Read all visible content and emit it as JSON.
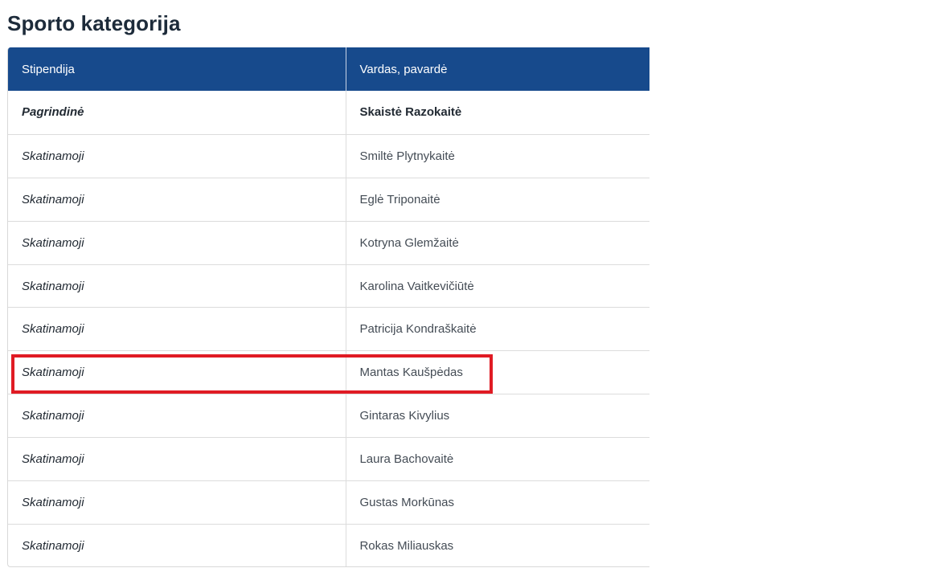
{
  "section_title": "Sporto kategorija",
  "table": {
    "headers": [
      "Stipendija",
      "Vardas, pavardė"
    ],
    "rows": [
      {
        "stipendija": "Pagrindinė",
        "vardas": "Skaistė Razokaitė"
      },
      {
        "stipendija": "Skatinamoji",
        "vardas": "Smiltė Plytnykaitė"
      },
      {
        "stipendija": "Skatinamoji",
        "vardas": "Eglė Triponaitė"
      },
      {
        "stipendija": "Skatinamoji",
        "vardas": "Kotryna Glemžaitė"
      },
      {
        "stipendija": "Skatinamoji",
        "vardas": "Karolina Vaitkevičiūtė"
      },
      {
        "stipendija": "Skatinamoji",
        "vardas": "Patricija Kondraškaitė"
      },
      {
        "stipendija": "Skatinamoji",
        "vardas": "Mantas Kaušpėdas"
      },
      {
        "stipendija": "Skatinamoji",
        "vardas": "Gintaras Kivylius"
      },
      {
        "stipendija": "Skatinamoji",
        "vardas": "Laura Bachovaitė"
      },
      {
        "stipendija": "Skatinamoji",
        "vardas": "Gustas Morkūnas"
      },
      {
        "stipendija": "Skatinamoji",
        "vardas": "Rokas Miliauskas"
      }
    ],
    "highlighted_row_index": 6
  },
  "colors": {
    "header_bg": "#174a8c",
    "highlight": "#e01b24",
    "title": "#1d2b3a"
  }
}
